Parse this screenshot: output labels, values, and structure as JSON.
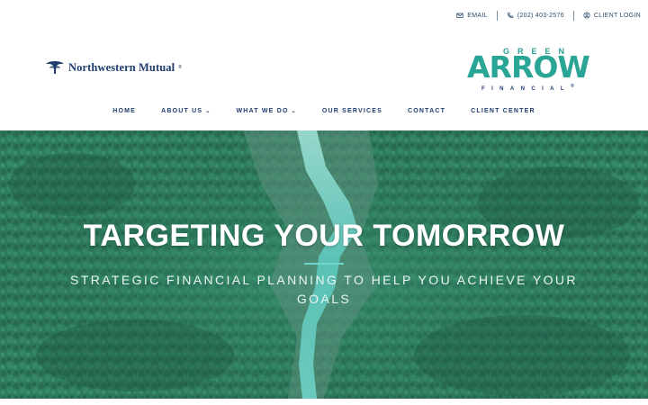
{
  "utility": {
    "email_label": "EMAIL",
    "phone_label": "(202) 403-2576",
    "login_label": "CLIENT LOGIN",
    "icons": [
      "envelope-icon",
      "phone-icon",
      "user-icon"
    ]
  },
  "logos": {
    "partner_name": "Northwestern Mutual",
    "brand_top": "GREEN",
    "brand_main": "ARROW",
    "brand_bottom": "FINANCIAL",
    "brand_color": "#29a596",
    "navy": "#1e3c6e"
  },
  "nav": {
    "items": [
      {
        "label": "HOME"
      },
      {
        "label": "ABOUT US"
      },
      {
        "label": "WHAT WE DO"
      },
      {
        "label": "OUR SERVICES"
      },
      {
        "label": "CONTACT"
      },
      {
        "label": "CLIENT CENTER"
      }
    ],
    "dropdown_icon": "chevron-down-icon"
  },
  "hero": {
    "title": "TARGETING YOUR TOMORROW",
    "subtitle": "STRATEGIC FINANCIAL PLANNING TO HELP YOU ACHIEVE YOUR GOALS",
    "accent": "#6fd6c9",
    "overlay_color": "#2f7d62"
  }
}
